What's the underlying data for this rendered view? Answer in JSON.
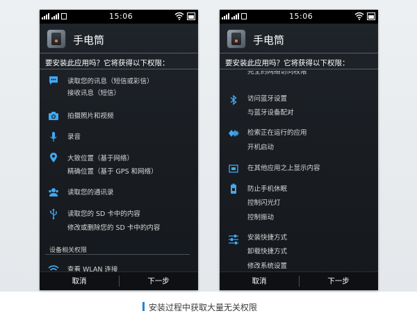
{
  "screens": [
    {
      "status": {
        "time": "15:06"
      },
      "app_name": "手电筒",
      "question": "要安装此应用吗？它将获得以下权限：",
      "groups": [
        {
          "icon": "message-icon",
          "lines": [
            "读取您的讯息（短信或彩信）",
            "接收讯息（短信）"
          ]
        },
        {
          "icon": "camera-icon",
          "lines": [
            "拍摄照片和视频"
          ]
        },
        {
          "icon": "microphone-icon",
          "lines": [
            "录音"
          ]
        },
        {
          "icon": "location-pin-icon",
          "lines": [
            "大致位置（基于网络）",
            "精确位置（基于 GPS 和网络）"
          ]
        },
        {
          "icon": "contacts-icon",
          "lines": [
            "读取您的通讯录"
          ]
        },
        {
          "icon": "usb-icon",
          "lines": [
            "读取您的 SD 卡中的内容",
            "修改或删除您的 SD 卡中的内容"
          ]
        }
      ],
      "section_title": "设备相关权限",
      "tail_group": {
        "icon": "wifi-icon",
        "lines": [
          "查看 WLAN 连接"
        ]
      },
      "buttons": {
        "cancel": "取消",
        "next": "下一步"
      }
    },
    {
      "status": {
        "time": "15:06"
      },
      "app_name": "手电筒",
      "question": "要安装此应用吗？它将获得以下权限：",
      "partial_top": "完全的网络访问权限",
      "groups": [
        {
          "icon": "bluetooth-icon",
          "lines": [
            "访问蓝牙设置",
            "与蓝牙设备配对"
          ]
        },
        {
          "icon": "running-apps-icon",
          "lines": [
            "检索正在运行的应用",
            "开机启动"
          ]
        },
        {
          "icon": "overlay-window-icon",
          "lines": [
            "在其他应用之上显示内容"
          ]
        },
        {
          "icon": "battery-lock-icon",
          "lines": [
            "防止手机休眠",
            "控制闪光灯",
            "控制振动"
          ]
        },
        {
          "icon": "settings-sliders-icon",
          "lines": [
            "安装快捷方式",
            "卸载快捷方式",
            "修改系统设置"
          ]
        }
      ],
      "buttons": {
        "cancel": "取消",
        "next": "下一步"
      }
    }
  ],
  "caption": "安装过程中获取大量无关权限",
  "colors": {
    "accent_blue": "#3fa9f5",
    "caption_bar": "#2b7fd3",
    "screen_bg": "#1a1e23"
  }
}
